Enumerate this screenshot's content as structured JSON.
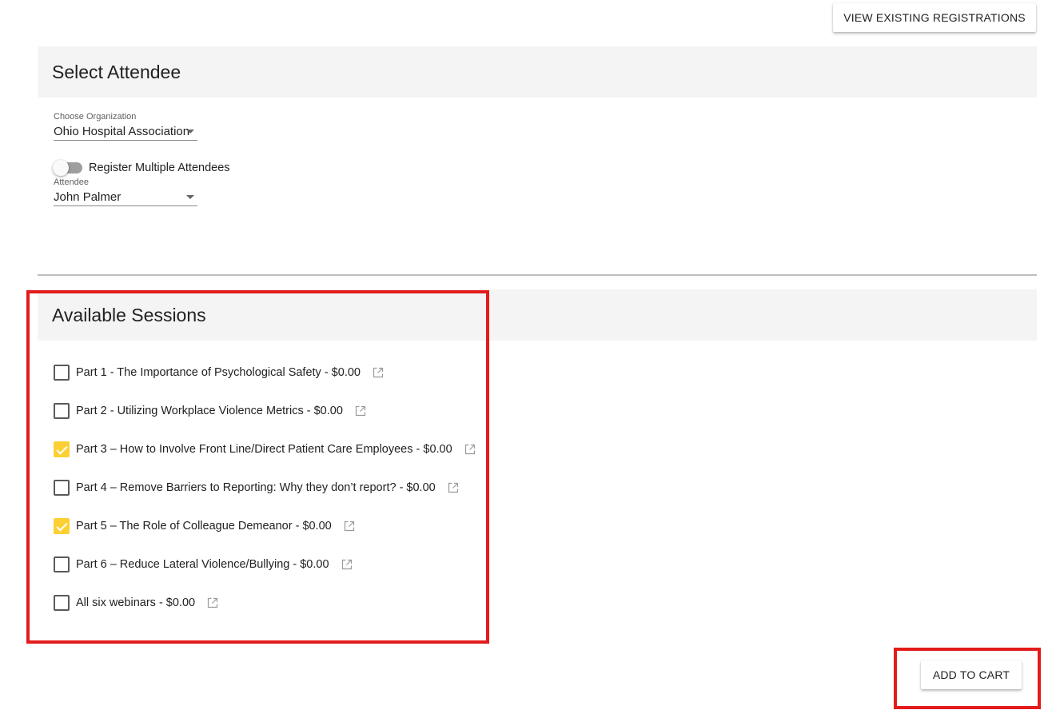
{
  "header": {
    "view_registrations_label": "VIEW EXISTING REGISTRATIONS"
  },
  "attendee_section": {
    "title": "Select Attendee",
    "organization": {
      "label": "Choose Organization",
      "value": "Ohio Hospital Association"
    },
    "multiple_toggle": {
      "label": "Register Multiple Attendees",
      "on": false
    },
    "attendee": {
      "label": "Attendee",
      "value": "John Palmer"
    }
  },
  "sessions_section": {
    "title": "Available Sessions",
    "sessions": [
      {
        "label": "Part 1 - The Importance of Psychological Safety - $0.00",
        "checked": false,
        "icon": "open-in-new-icon"
      },
      {
        "label": "Part 2 - Utilizing Workplace Violence Metrics - $0.00",
        "checked": false,
        "icon": "open-in-new-icon"
      },
      {
        "label": "Part 3 – How to Involve Front Line/Direct Patient Care Employees - $0.00",
        "checked": true,
        "icon": "open-in-new-icon"
      },
      {
        "label": "Part 4 – Remove Barriers to Reporting: Why they don’t report? - $0.00",
        "checked": false,
        "icon": "open-in-new-icon"
      },
      {
        "label": "Part 5 – The Role of Colleague Demeanor - $0.00",
        "checked": true,
        "icon": "open-in-new-icon"
      },
      {
        "label": "Part 6 – Reduce Lateral Violence/Bullying - $0.00",
        "checked": false,
        "icon": "open-in-new-icon"
      },
      {
        "label": "All six webinars - $0.00",
        "checked": false,
        "icon": "open-in-new-icon"
      }
    ]
  },
  "footer": {
    "add_to_cart_label": "ADD TO CART"
  },
  "colors": {
    "checkbox_checked": "#fcd035",
    "highlight_box": "#e31b1b",
    "section_header_bg": "#f4f4f4"
  }
}
